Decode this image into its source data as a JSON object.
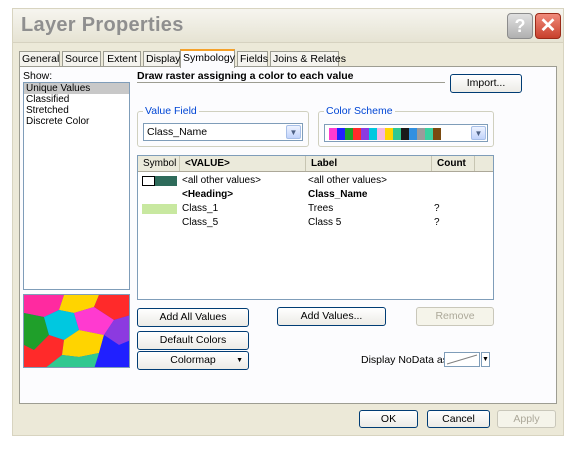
{
  "window": {
    "title": "Layer Properties",
    "help_glyph": "?",
    "close_glyph": "✕"
  },
  "tabs": [
    {
      "label": "General"
    },
    {
      "label": "Source"
    },
    {
      "label": "Extent"
    },
    {
      "label": "Display"
    },
    {
      "label": "Symbology",
      "active": true
    },
    {
      "label": "Fields"
    },
    {
      "label": "Joins & Relates"
    }
  ],
  "show": {
    "label": "Show:",
    "items": [
      "Unique Values",
      "Classified",
      "Stretched",
      "Discrete Color"
    ],
    "selected": "Unique Values"
  },
  "heading": "Draw raster assigning a color to each value",
  "import_label": "Import...",
  "value_field": {
    "label": "Value Field",
    "value": "Class_Name",
    "arrow": "▼"
  },
  "color_scheme": {
    "label": "Color Scheme",
    "arrow": "▼",
    "colors": [
      "#ff3ad0",
      "#2020ff",
      "#1f9f2a",
      "#ff2a2a",
      "#8c3ae0",
      "#00c8e0",
      "#f4b8e0",
      "#ffd400",
      "#30c890",
      "#1a1a1a",
      "#3090e0",
      "#9b9b9b",
      "#3ad0a0",
      "#7a4a10"
    ]
  },
  "table": {
    "columns": [
      "Symbol",
      "<VALUE>",
      "Label",
      "Count"
    ],
    "rows": [
      {
        "symbol_color": "#2e6b5a",
        "symbol_outline": true,
        "value": "<all other values>",
        "label": "<all other values>",
        "count": "",
        "bold": false
      },
      {
        "symbol_color": "",
        "value": "<Heading>",
        "label": "Class_Name",
        "count": "",
        "bold": true
      },
      {
        "symbol_color": "#c8e8a0",
        "value": "Class_1",
        "label": "Trees",
        "count": "?",
        "bold": false
      },
      {
        "symbol_color": "",
        "value": "Class_5",
        "label": "Class 5",
        "count": "?",
        "bold": false
      }
    ]
  },
  "buttons": {
    "add_all_values": "Add All Values",
    "add_values": "Add Values...",
    "remove": "Remove",
    "default_colors": "Default Colors",
    "colormap": "Colormap",
    "colormap_arrow": "▼",
    "ok": "OK",
    "cancel": "Cancel",
    "apply": "Apply"
  },
  "nodata": {
    "label": "Display NoData as",
    "arrow": "▼"
  }
}
